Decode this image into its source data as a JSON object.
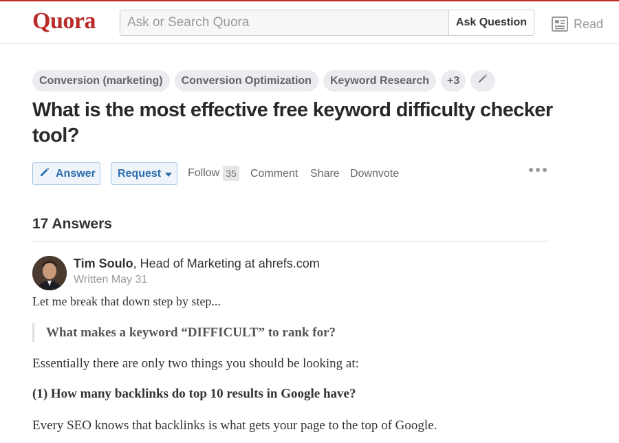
{
  "header": {
    "logo": "Quora",
    "search_placeholder": "Ask or Search Quora",
    "ask_label": "Ask Question",
    "read_label": "Read"
  },
  "topics": {
    "items": [
      "Conversion (marketing)",
      "Conversion Optimization",
      "Keyword Research"
    ],
    "more": "+3"
  },
  "question": {
    "title": "What is the most effective free keyword difficulty checker tool?"
  },
  "actions": {
    "answer": "Answer",
    "request": "Request",
    "follow": "Follow",
    "follow_count": "35",
    "comment": "Comment",
    "share": "Share",
    "downvote": "Downvote"
  },
  "answers": {
    "count_label": "17 Answers",
    "first": {
      "author": "Tim Soulo",
      "credential": ", Head of Marketing at ahrefs.com",
      "written": "Written May 31",
      "body": {
        "p1": "Let me break that down step by step...",
        "quote": "What makes a keyword “DIFFICULT” to rank for?",
        "p2": "Essentially there are only two things you should be looking at:",
        "heading1": "(1) How many backlinks do top 10 results in Google have?",
        "p3": "Every SEO knows that backlinks is what gets your page to the top of Google."
      }
    }
  },
  "colors": {
    "brand": "#b92b27",
    "link_blue": "#2b6dad",
    "chip_bg": "#ebebf0"
  },
  "icons": {
    "answer": "pencil-icon",
    "edit_topics": "pencil-icon",
    "read": "newspaper-icon",
    "more": "more-dots-icon"
  }
}
